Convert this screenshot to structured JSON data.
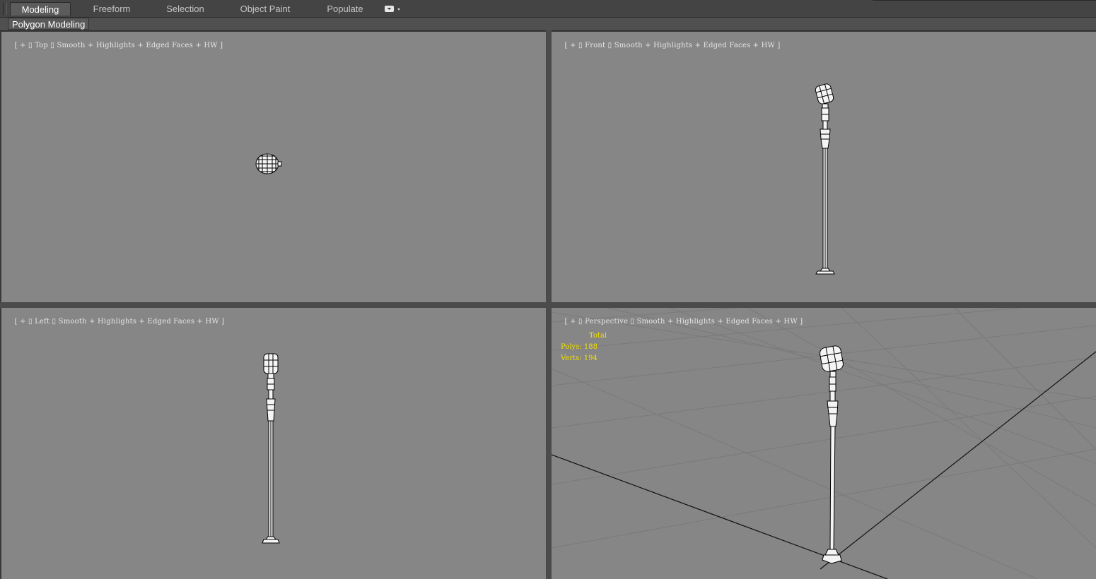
{
  "ribbon": {
    "tabs": [
      {
        "label": "Modeling",
        "active": true
      },
      {
        "label": "Freeform",
        "active": false
      },
      {
        "label": "Selection",
        "active": false
      },
      {
        "label": "Object Paint",
        "active": false
      },
      {
        "label": "Populate",
        "active": false
      }
    ],
    "panel_label": "Polygon Modeling"
  },
  "viewports": {
    "top": {
      "bracket_open": "[",
      "plus": "+",
      "view": "Top",
      "shading": "Smooth + Highlights + Edged Faces + HW",
      "bracket_close": "]"
    },
    "front": {
      "bracket_open": "[",
      "plus": "+",
      "view": "Front",
      "shading": "Smooth + Highlights + Edged Faces + HW",
      "bracket_close": "]"
    },
    "left": {
      "bracket_open": "[",
      "plus": "+",
      "view": "Left",
      "shading": "Smooth + Highlights + Edged Faces + HW",
      "bracket_close": "]"
    },
    "perspective": {
      "bracket_open": "[",
      "plus": "+",
      "view": "Perspective",
      "shading": "Smooth + Highlights + Edged Faces + HW",
      "bracket_close": "]"
    }
  },
  "stats": {
    "title": "Total",
    "polys_label": "Polys:",
    "polys_value": "188",
    "verts_label": "Verts:",
    "verts_value": "194"
  },
  "colors": {
    "viewport_bg": "#868686",
    "stats_text": "#f2e000",
    "wire": "#000000",
    "model_fill": "#f4f4f4"
  }
}
